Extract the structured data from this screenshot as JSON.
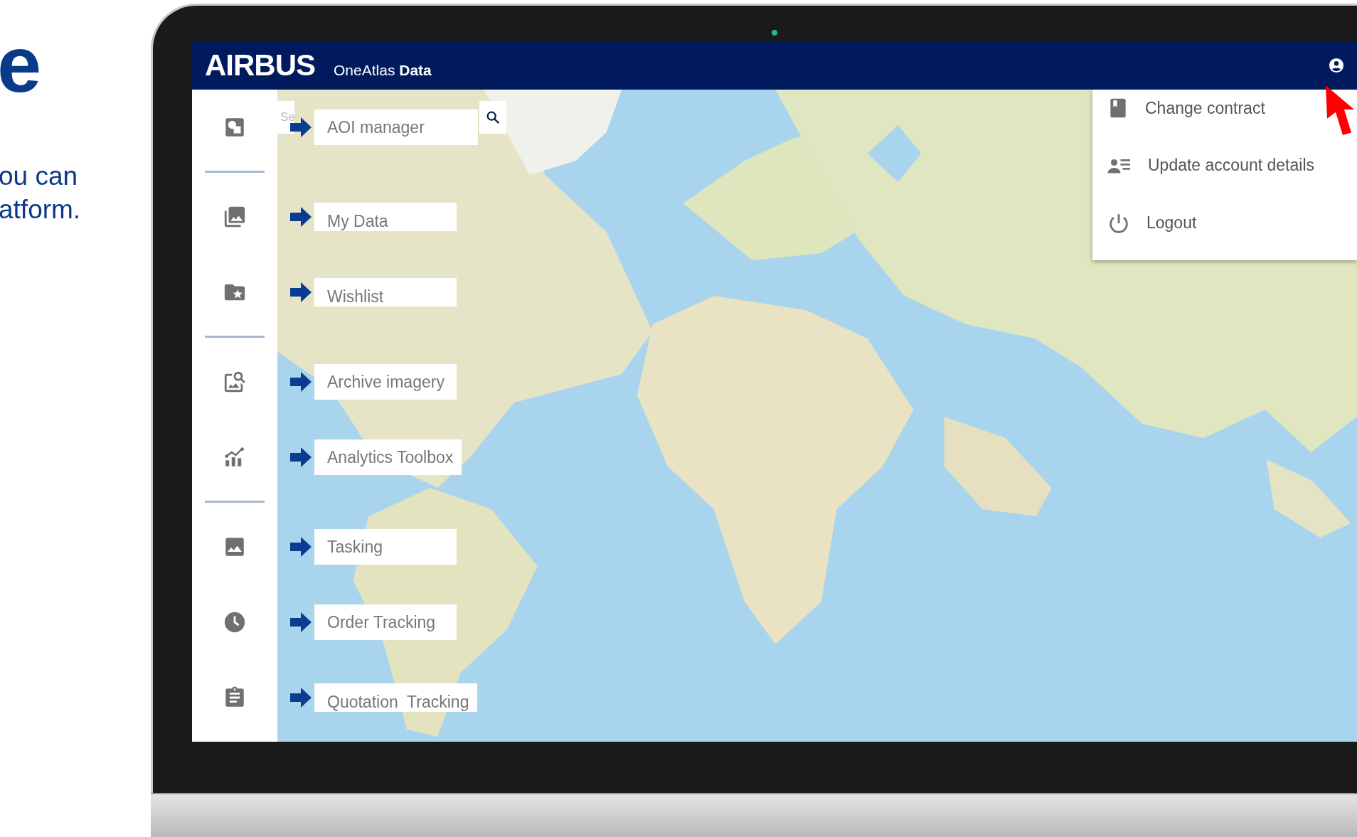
{
  "slide": {
    "heading": "e",
    "body": [
      "ou can",
      "atform."
    ]
  },
  "header": {
    "logo": "AIRBUS",
    "product": "OneAtlas **Data**"
  },
  "search": {
    "placeholder": "Se"
  },
  "sidebar": {
    "items": [
      {
        "kind": "aoi",
        "callout": "AOI manager",
        "divider_after": true
      },
      {
        "kind": "data",
        "callout": "My Data",
        "divider_after": false
      },
      {
        "kind": "wishlist",
        "callout": "Wishlist",
        "divider_after": true
      },
      {
        "kind": "archive",
        "callout": "Archive imagery",
        "divider_after": false
      },
      {
        "kind": "analytics",
        "callout": "Analytics Toolbox",
        "divider_after": true
      },
      {
        "kind": "tasking",
        "callout": "Tasking",
        "divider_after": false
      },
      {
        "kind": "orders",
        "callout": "Order Tracking",
        "divider_after": false
      },
      {
        "kind": "quotation",
        "callout": "Quotation  Tracking",
        "divider_after": false
      }
    ]
  },
  "user_menu": {
    "items": [
      {
        "kind": "contract",
        "label": "Change contract"
      },
      {
        "kind": "account",
        "label": "Update account details"
      },
      {
        "kind": "logout",
        "label": "Logout"
      }
    ]
  }
}
